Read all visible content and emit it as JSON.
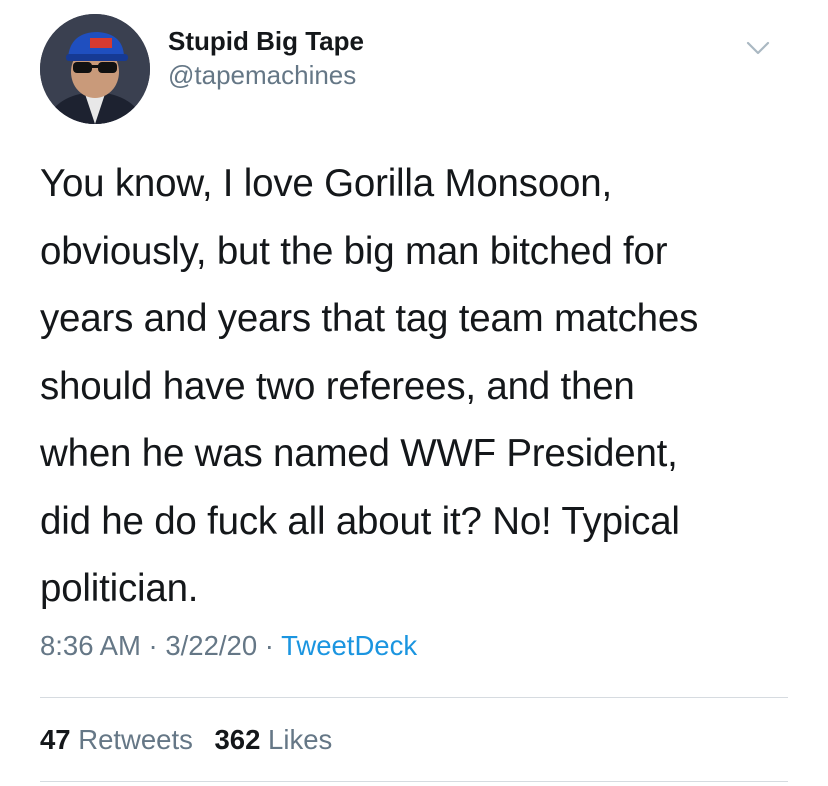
{
  "user": {
    "display_name": "Stupid Big Tape",
    "handle": "@tapemachines"
  },
  "tweet": {
    "lines": [
      "You know, I love Gorilla Monsoon,",
      "obviously, but the big man bitched for",
      "years and years that tag team matches",
      "should have two referees, and then",
      "when he was named WWF President,",
      "did he do fuck all about it? No! Typical",
      "politician."
    ],
    "time": "8:36 AM",
    "date": "3/22/20",
    "source": "TweetDeck",
    "separator": " · "
  },
  "stats": {
    "retweets_count": "47",
    "retweets_label": "Retweets",
    "likes_count": "362",
    "likes_label": "Likes"
  },
  "colors": {
    "text": "#14171a",
    "secondary": "#657786",
    "link": "#1b95e0",
    "divider": "#d6dbe0"
  },
  "icons": {
    "menu": "chevron-down-icon"
  }
}
